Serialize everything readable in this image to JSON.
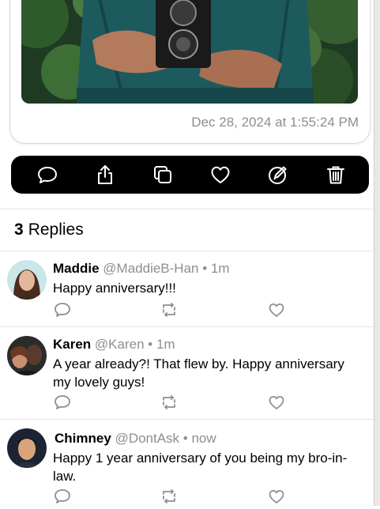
{
  "post": {
    "timestamp": "Dec 28, 2024 at 1:55:24 PM"
  },
  "toolbar": {
    "icons": [
      "reply-icon",
      "share-icon",
      "copy-icon",
      "like-icon",
      "edit-icon",
      "delete-icon"
    ]
  },
  "replies_section": {
    "count": "3",
    "label": "Replies"
  },
  "replies": [
    {
      "name": "Maddie",
      "handle": "@MaddieB-Han",
      "separator": "•",
      "time": "1m",
      "text": "Happy anniversary!!!"
    },
    {
      "name": "Karen",
      "handle": "@Karen",
      "separator": "•",
      "time": "1m",
      "text": "A year already?! That flew by. Happy anniversary my lovely guys!"
    },
    {
      "name": "Chimney",
      "handle": "@DontAsk",
      "separator": "•",
      "time": "now",
      "text": "Happy 1 year anniversary of you being my bro-in-law."
    }
  ],
  "colors": {
    "toolbar_bg": "#000000",
    "secondary_text": "#8e8e93",
    "divider": "#e5e5e5"
  }
}
